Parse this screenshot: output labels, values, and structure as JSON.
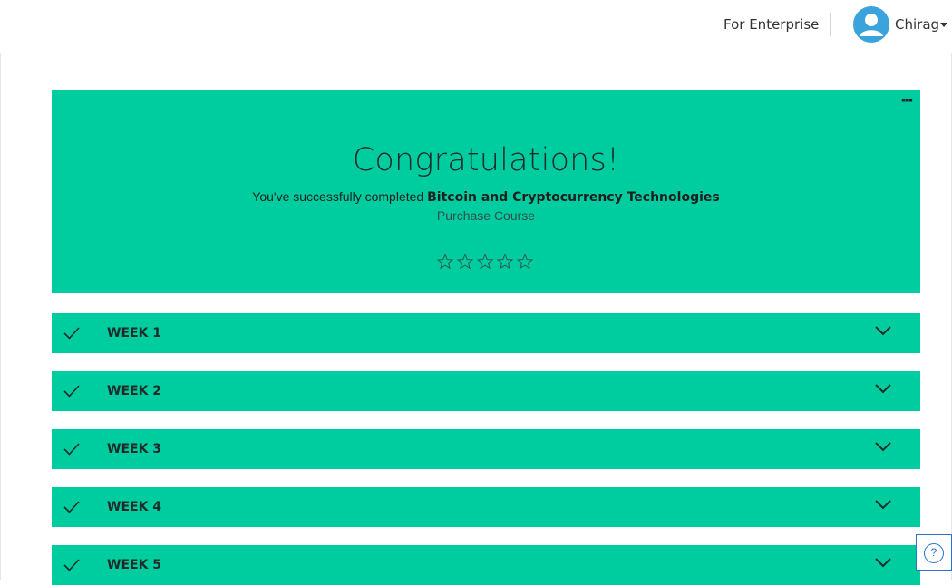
{
  "header": {
    "enterprise_link": "For Enterprise",
    "user_name": "Chirag",
    "avatar_color": "#3aa3dc"
  },
  "hero": {
    "title": "Congratulations!",
    "completed_prefix": "You've successfully completed ",
    "course_name": "Bitcoin and Cryptocurrency Technologies",
    "purchase_label": "Purchase Course",
    "more_icon": "ellipsis-icon",
    "rating_stars": 5,
    "rating_value": 0,
    "background_color": "#00cd9f"
  },
  "weeks": [
    {
      "label": "WEEK 1",
      "completed": true
    },
    {
      "label": "WEEK 2",
      "completed": true
    },
    {
      "label": "WEEK 3",
      "completed": true
    },
    {
      "label": "WEEK 4",
      "completed": true
    },
    {
      "label": "WEEK 5",
      "completed": true
    }
  ],
  "help": {
    "icon": "help-icon",
    "glyph": "?",
    "accent_color": "#2a73cc"
  }
}
